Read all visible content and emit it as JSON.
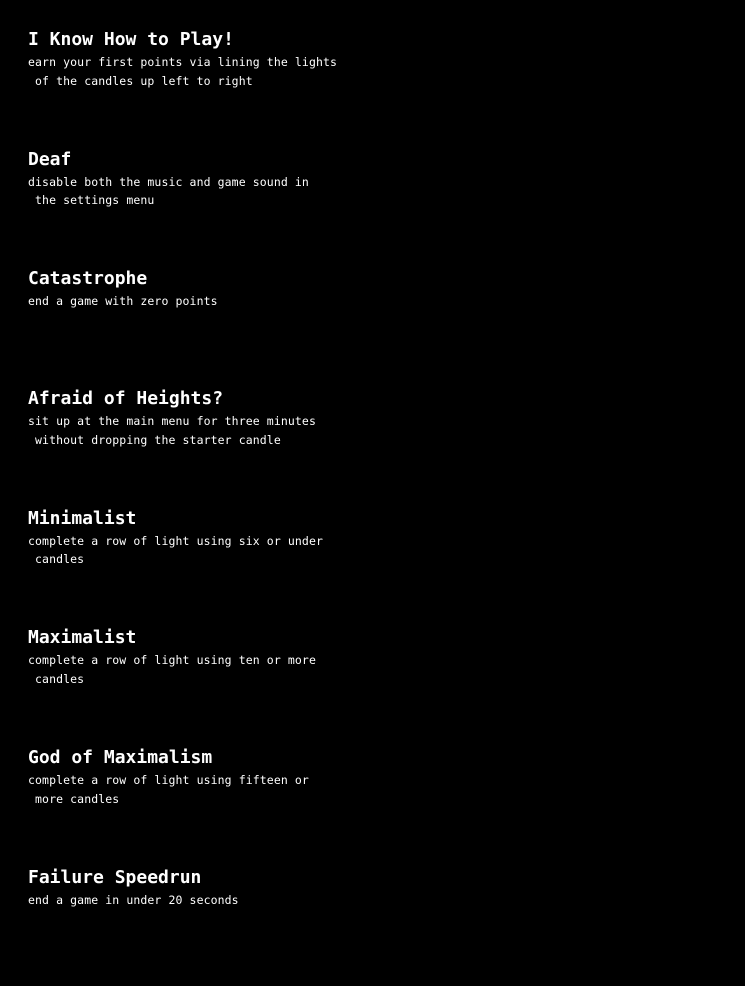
{
  "achievements": [
    {
      "title": "I Know How to Play!",
      "line1": "earn your first points via lining the lights",
      "line2": " of the candles up left to right"
    },
    {
      "title": "Deaf",
      "line1": "disable both the music and game sound in",
      "line2": " the settings menu"
    },
    {
      "title": "Catastrophe",
      "line1": "end a game with zero points",
      "line2": ""
    },
    {
      "title": "Afraid of Heights?",
      "line1": "sit up at the main menu for three minutes",
      "line2": " without dropping the starter candle"
    },
    {
      "title": "Minimalist",
      "line1": "complete a row of light using six or under",
      "line2": " candles"
    },
    {
      "title": "Maximalist",
      "line1": "complete a row of light using ten or more",
      "line2": " candles"
    },
    {
      "title": "God of Maximalism",
      "line1": "complete a row of light using fifteen or",
      "line2": " more candles"
    },
    {
      "title": "Failure Speedrun",
      "line1": "end a game in under 20 seconds",
      "line2": ""
    }
  ],
  "colors": {
    "background": "#000000",
    "text": "#ffffff"
  }
}
